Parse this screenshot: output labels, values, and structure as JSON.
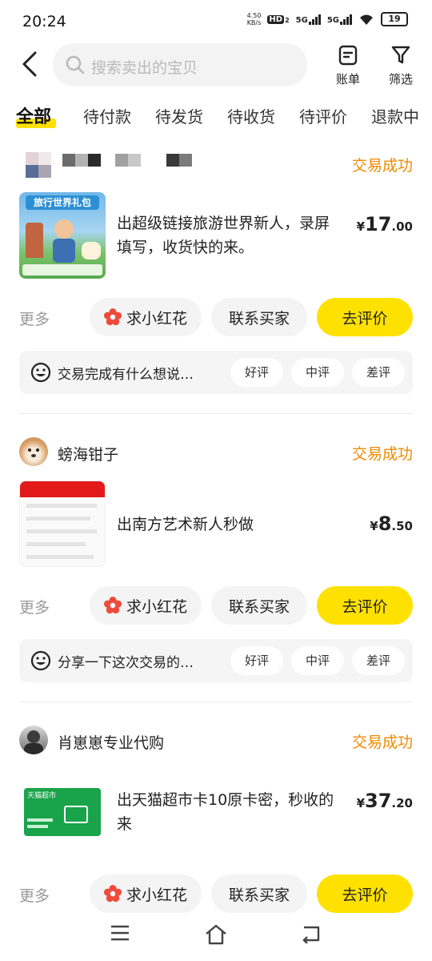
{
  "status_bar": {
    "time": "20:24",
    "net_speed_value": "4.50",
    "net_speed_unit": "KB/s",
    "hd_label": "HD",
    "hd_sub": "2",
    "sig1_label": "5G",
    "sig2_label": "5G",
    "battery": "19"
  },
  "header": {
    "search_placeholder": "搜索卖出的宝贝",
    "bill_label": "账单",
    "filter_label": "筛选"
  },
  "tabs": [
    "全部",
    "待付款",
    "待发货",
    "待收货",
    "待评价",
    "退款中"
  ],
  "orders": [
    {
      "seller": "",
      "status": "交易成功",
      "title": "出超级链接旅游世界新人，录屏填写，收货快的来。",
      "price_symbol": "¥",
      "price_int": "17",
      "price_dec": ".00",
      "more": "更多",
      "btn_flower": "求小红花",
      "btn_contact": "联系买家",
      "btn_review": "去评价",
      "review_prompt": "交易完成有什么想说…",
      "rate_good": "好评",
      "rate_mid": "中评",
      "rate_bad": "差评",
      "thumb_title": "旅行世界礼包"
    },
    {
      "seller": "螃海钳子",
      "status": "交易成功",
      "title": "出南方艺术新人秒做",
      "price_symbol": "¥",
      "price_int": "8",
      "price_dec": ".50",
      "more": "更多",
      "btn_flower": "求小红花",
      "btn_contact": "联系买家",
      "btn_review": "去评价",
      "review_prompt": "分享一下这次交易的…",
      "rate_good": "好评",
      "rate_mid": "中评",
      "rate_bad": "差评"
    },
    {
      "seller": "肖崽崽专业代购",
      "status": "交易成功",
      "title": "出天猫超市卡10原卡密，秒收的来",
      "price_symbol": "¥",
      "price_int": "37",
      "price_dec": ".20",
      "more": "更多",
      "btn_flower": "求小红花",
      "btn_contact": "联系买家",
      "btn_review": "去评价",
      "thumb_title": "天猫超市"
    }
  ],
  "colors": {
    "accent_yellow": "#ffe100",
    "status_orange": "#f08a00"
  },
  "icons": {
    "back": "chevron-left-icon",
    "search": "search-icon",
    "bill": "bill-icon",
    "filter": "filter-icon",
    "flower": "flower-icon",
    "face": "smile-face-icon",
    "nav_menu": "menu-icon",
    "nav_home": "home-icon",
    "nav_back": "back-icon"
  }
}
